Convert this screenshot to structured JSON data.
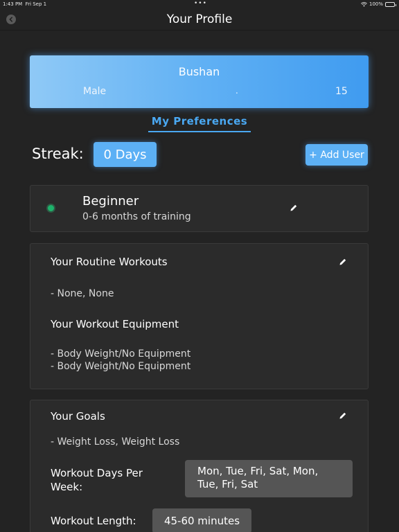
{
  "status_bar": {
    "time": "1:43 PM",
    "date": "Fri Sep 1",
    "battery": "100%"
  },
  "nav": {
    "title": "Your Profile"
  },
  "profile": {
    "name": "Bushan",
    "gender": "Male",
    "separator": ".",
    "age": "15"
  },
  "preferences_link": "My Preferences",
  "streak": {
    "label": "Streak:",
    "value": "0 Days"
  },
  "add_user_label": "+ Add User",
  "level": {
    "title": "Beginner",
    "subtitle": "0-6 months of training"
  },
  "routine": {
    "workouts_title": "Your Routine Workouts",
    "workouts_value": "- None, None",
    "equipment_title": "Your Workout Equipment",
    "equipment_items": [
      "- Body Weight/No Equipment",
      "- Body Weight/No Equipment"
    ]
  },
  "goals": {
    "title": "Your Goals",
    "value": "- Weight Loss, Weight Loss",
    "days_label": "Workout Days Per Week:",
    "days_label_line1": "Workout Days Per",
    "days_label_line2": "Week:",
    "days_value_line1": "Mon, Tue, Fri, Sat, Mon,",
    "days_value_line2": "Tue, Fri, Sat",
    "length_label": "Workout Length:",
    "length_value": "45-60 minutes"
  },
  "colors": {
    "background": "#232323",
    "card": "#2b2b2b",
    "accent": "#4aa8f2",
    "button": "#5cb0f5",
    "status_dot": "#1db36b",
    "value_box": "#555555"
  }
}
